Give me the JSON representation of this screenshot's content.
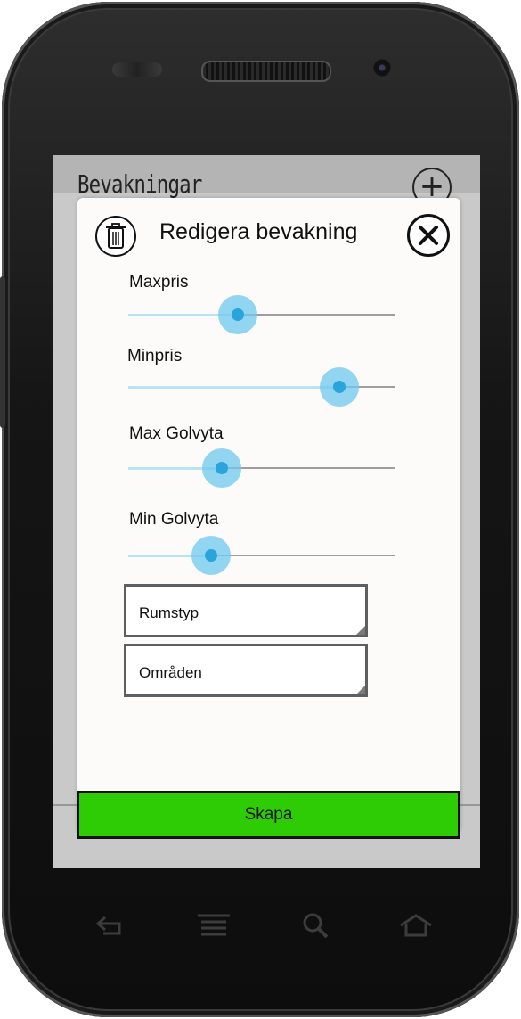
{
  "app": {
    "screen_title": "Bevakningar"
  },
  "dialog": {
    "title": "Redigera bevakning",
    "sliders": [
      {
        "label": "Maxpris",
        "value_fraction": 0.41
      },
      {
        "label": "Minpris",
        "value_fraction": 0.79
      },
      {
        "label": "Max Golvyta",
        "value_fraction": 0.35
      },
      {
        "label": "Min Golvyta",
        "value_fraction": 0.31
      }
    ],
    "room_type_placeholder": "Rumstyp",
    "areas_placeholder": "Områden",
    "create_label": "Skapa"
  },
  "colors": {
    "accent": "#2aa5db",
    "slider_halo": "#6fc8ed",
    "create_button": "#2ecc05"
  },
  "icons": [
    "trash-icon",
    "close-icon",
    "plus-icon",
    "back-icon",
    "menu-icon",
    "search-icon",
    "home-icon"
  ]
}
